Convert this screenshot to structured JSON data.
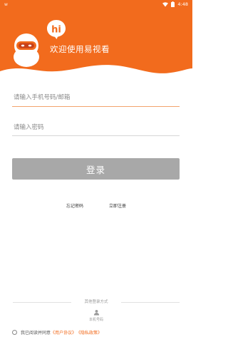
{
  "status_bar": {
    "left_text": "w",
    "time": "4:48"
  },
  "header": {
    "logo_text": "hi",
    "welcome": "欢迎使用易视看",
    "bg_color": "#f26b1d"
  },
  "form": {
    "phone_placeholder": "请输入手机号码/邮箱",
    "phone_value": "",
    "password_placeholder": "请输入密码",
    "password_value": "",
    "login_label": "登录"
  },
  "links": {
    "forgot": "忘记密码",
    "register": "立即注册"
  },
  "other_login": {
    "title": "其他登录方式",
    "local_label": "本机号码"
  },
  "agreement": {
    "prefix": "我已阅读并同意",
    "user_agreement": "《用户协议》",
    "privacy_policy": "《隐私政策》"
  },
  "colors": {
    "accent": "#f26b1d",
    "button_disabled": "#a8a8a8"
  }
}
